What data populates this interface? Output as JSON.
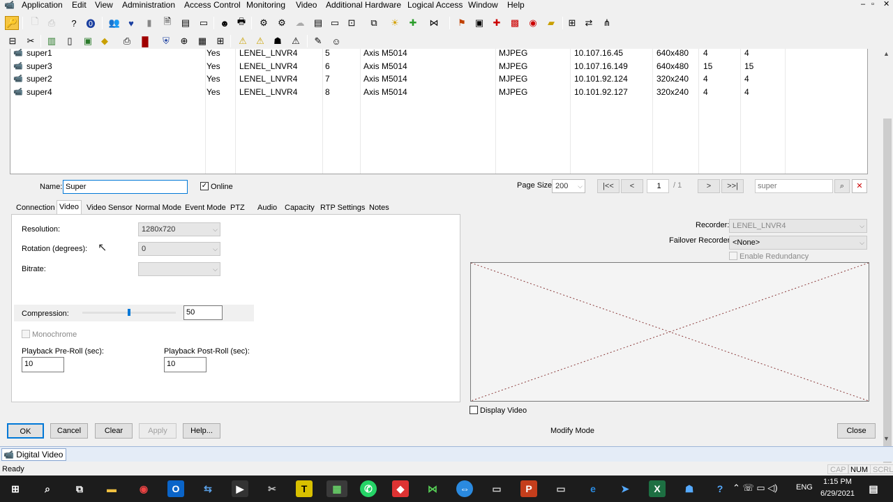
{
  "menu": [
    "Application",
    "Edit",
    "View",
    "Administration",
    "Access Control",
    "Monitoring",
    "Video",
    "Additional Hardware",
    "Logical Access",
    "Window",
    "Help"
  ],
  "window_controls": [
    "–",
    "▫",
    "✕"
  ],
  "grid": {
    "rows": [
      {
        "name": "super1",
        "online": "Yes",
        "recorder": "LENEL_LNVR4",
        "channel": "5",
        "type": "Axis M5014",
        "format": "MJPEG",
        "ip": "10.107.16.45",
        "res": "640x480",
        "a": "4",
        "b": "4"
      },
      {
        "name": "super3",
        "online": "Yes",
        "recorder": "LENEL_LNVR4",
        "channel": "6",
        "type": "Axis M5014",
        "format": "MJPEG",
        "ip": "10.107.16.149",
        "res": "640x480",
        "a": "15",
        "b": "15"
      },
      {
        "name": "super2",
        "online": "Yes",
        "recorder": "LENEL_LNVR4",
        "channel": "7",
        "type": "Axis M5014",
        "format": "MJPEG",
        "ip": "10.101.92.124",
        "res": "320x240",
        "a": "4",
        "b": "4"
      },
      {
        "name": "super4",
        "online": "Yes",
        "recorder": "LENEL_LNVR4",
        "channel": "8",
        "type": "Axis M5014",
        "format": "MJPEG",
        "ip": "10.101.92.127",
        "res": "320x240",
        "a": "4",
        "b": "4"
      }
    ]
  },
  "form": {
    "name_label": "Name:",
    "name_value": "Super",
    "online_label": "Online",
    "page_size_label": "Page Size:",
    "page_size_value": "200",
    "page_number": "1",
    "page_total": "/ 1",
    "search_value": "super"
  },
  "tabs": [
    "Connection",
    "Video",
    "Video Sensor",
    "Normal Mode",
    "Event Mode",
    "PTZ",
    "Audio",
    "Capacity",
    "RTP Settings",
    "Notes"
  ],
  "video": {
    "resolution_label": "Resolution:",
    "resolution_value": "1280x720",
    "rotation_label": "Rotation (degrees):",
    "rotation_value": "0",
    "bitrate_label": "Bitrate:",
    "compression_label": "Compression:",
    "compression_value": "50",
    "compression_fraction": 0.5,
    "monochrome_label": "Monochrome",
    "preroll_label": "Playback Pre-Roll (sec):",
    "preroll_value": "10",
    "postroll_label": "Playback Post-Roll (sec):",
    "postroll_value": "10"
  },
  "recorder": {
    "recorder_label": "Recorder:",
    "recorder_value": "LENEL_LNVR4",
    "failover_label": "Failover Recorder:",
    "failover_value": "<None>",
    "redundancy_label": "Enable Redundancy",
    "display_video_label": "Display Video"
  },
  "buttons": {
    "ok": "OK",
    "cancel": "Cancel",
    "clear": "Clear",
    "apply": "Apply",
    "help": "Help...",
    "close": "Close"
  },
  "mode_text": "Modify Mode",
  "doc_tab": "Digital Video",
  "status": {
    "text": "Ready",
    "cap": "CAP",
    "num": "NUM",
    "scrl": "SCRL"
  },
  "taskbar": {
    "lang": "ENG",
    "time": "1:15 PM",
    "date": "6/29/2021"
  }
}
